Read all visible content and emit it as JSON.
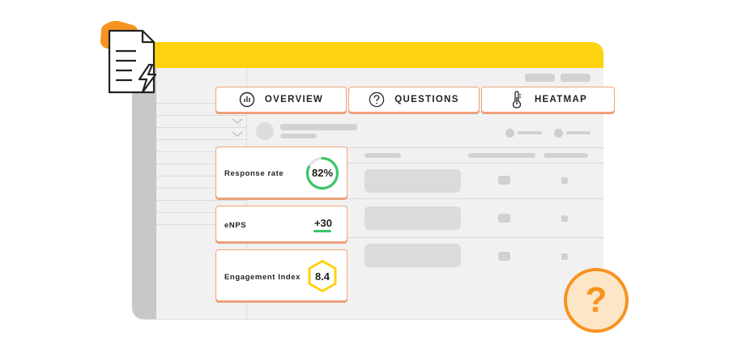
{
  "tabs": [
    {
      "label": "OVERVIEW",
      "icon": "bar-chart-icon"
    },
    {
      "label": "QUESTIONS",
      "icon": "question-circle-icon"
    },
    {
      "label": "HEATMAP",
      "icon": "thermometer-icon"
    }
  ],
  "metrics": {
    "response_rate": {
      "label": "Response rate",
      "value": "82%",
      "fraction": 0.82,
      "color": "#3cc46b"
    },
    "enps": {
      "label": "eNPS",
      "value": "+30",
      "color": "#3cc46b"
    },
    "engagement": {
      "label": "Engagement Index",
      "value": "8.4",
      "color": "#fdd20f"
    }
  },
  "colors": {
    "titlebar": "#fdd20f",
    "accent_orange": "#f7931e",
    "card_border": "#f2a276",
    "help_fill": "#fde6c7"
  },
  "decor": {
    "document_icon": "document-lightning-icon",
    "help_badge": "?"
  }
}
